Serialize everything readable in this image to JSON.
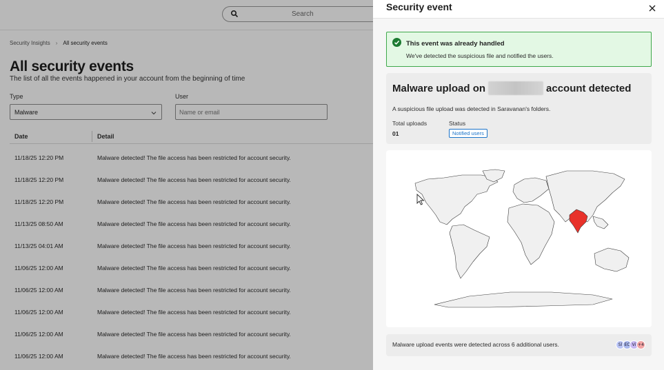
{
  "search": {
    "placeholder": "Search"
  },
  "breadcrumb": {
    "root": "Security Insights",
    "current": "All security events"
  },
  "page": {
    "title": "All security events",
    "subtitle": "The list of all the events happened in your account from the beginning of time"
  },
  "filters": {
    "type_label": "Type",
    "type_value": "Malware",
    "user_label": "User",
    "user_placeholder": "Name or email"
  },
  "table": {
    "columns": [
      "Date",
      "Detail"
    ],
    "rows": [
      {
        "date": "11/18/25 12:20 PM",
        "detail": "Malware detected! The file access has been restricted for account security."
      },
      {
        "date": "11/18/25 12:20 PM",
        "detail": "Malware detected! The file access has been restricted for account security."
      },
      {
        "date": "11/18/25 12:20 PM",
        "detail": "Malware detected! The file access has been restricted for account security."
      },
      {
        "date": "11/13/25 08:50 AM",
        "detail": "Malware detected! The file access has been restricted for account security."
      },
      {
        "date": "11/13/25 04:01 AM",
        "detail": "Malware detected! The file access has been restricted for account security."
      },
      {
        "date": "11/06/25 12:00 AM",
        "detail": "Malware detected! The file access has been restricted for account security."
      },
      {
        "date": "11/06/25 12:00 AM",
        "detail": "Malware detected! The file access has been restricted for account security."
      },
      {
        "date": "11/06/25 12:00 AM",
        "detail": "Malware detected! The file access has been restricted for account security."
      },
      {
        "date": "11/06/25 12:00 AM",
        "detail": "Malware detected! The file access has been restricted for account security."
      },
      {
        "date": "11/06/25 12:00 AM",
        "detail": "Malware detected! The file access has been restricted for account security."
      }
    ]
  },
  "panel": {
    "title": "Security event",
    "alert_title": "This event was already handled",
    "alert_text": "We've detected the suspicious file and notified the users.",
    "headline_prefix": "Malware upload on",
    "headline_suffix": "account detected",
    "description": "A suspicious file upload was detected in Saravanan's folders.",
    "total_label": "Total uploads",
    "total_value": "01",
    "status_label": "Status",
    "status_value": "Notified users",
    "footer_text": "Malware upload events were detected across 6 additional users.",
    "avatars": [
      {
        "initials": "Sl",
        "color": "#b9c4f5"
      },
      {
        "initials": "EC",
        "color": "#a9b8ee"
      },
      {
        "initials": "Vi",
        "color": "#c6b6f2"
      },
      {
        "initials": "+4",
        "color": "#f2a3a3"
      }
    ],
    "highlight_country": "India",
    "highlight_color": "#e8322b"
  }
}
